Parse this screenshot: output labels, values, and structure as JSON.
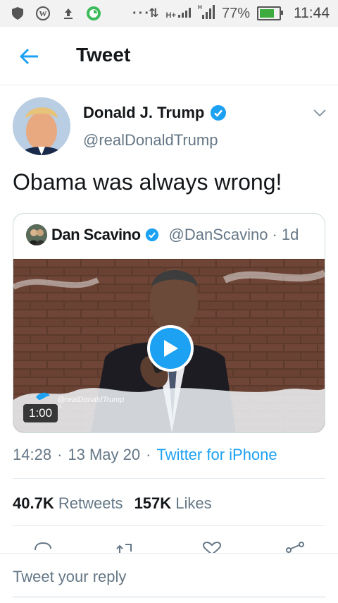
{
  "status_bar": {
    "battery": "77%",
    "battery_level": 0.77,
    "time": "11:44",
    "network": "H+"
  },
  "header": {
    "title": "Tweet"
  },
  "tweet": {
    "author_name": "Donald J. Trump",
    "author_handle": "@realDonaldTrump",
    "text": "Obama was always wrong!",
    "time": "14:28",
    "date": "13 May 20",
    "source": "Twitter for iPhone",
    "retweets_count": "40.7K",
    "retweets_label": "Retweets",
    "likes_count": "157K",
    "likes_label": "Likes"
  },
  "quoted_tweet": {
    "author_name": "Dan Scavino",
    "author_handle": "@DanScavino",
    "age": "1d",
    "video_duration": "1:00",
    "video_watermark": "@realDonaldTrump",
    "video_watermark_sub": "P"
  },
  "reply": {
    "placeholder": "Tweet your reply"
  },
  "colors": {
    "accent": "#1da1f2",
    "muted": "#657786",
    "text": "#14171a"
  },
  "icons": [
    "back-arrow-icon",
    "verified-icon",
    "chevron-down-icon",
    "play-icon",
    "reply-icon",
    "retweet-icon",
    "like-icon",
    "share-icon"
  ]
}
